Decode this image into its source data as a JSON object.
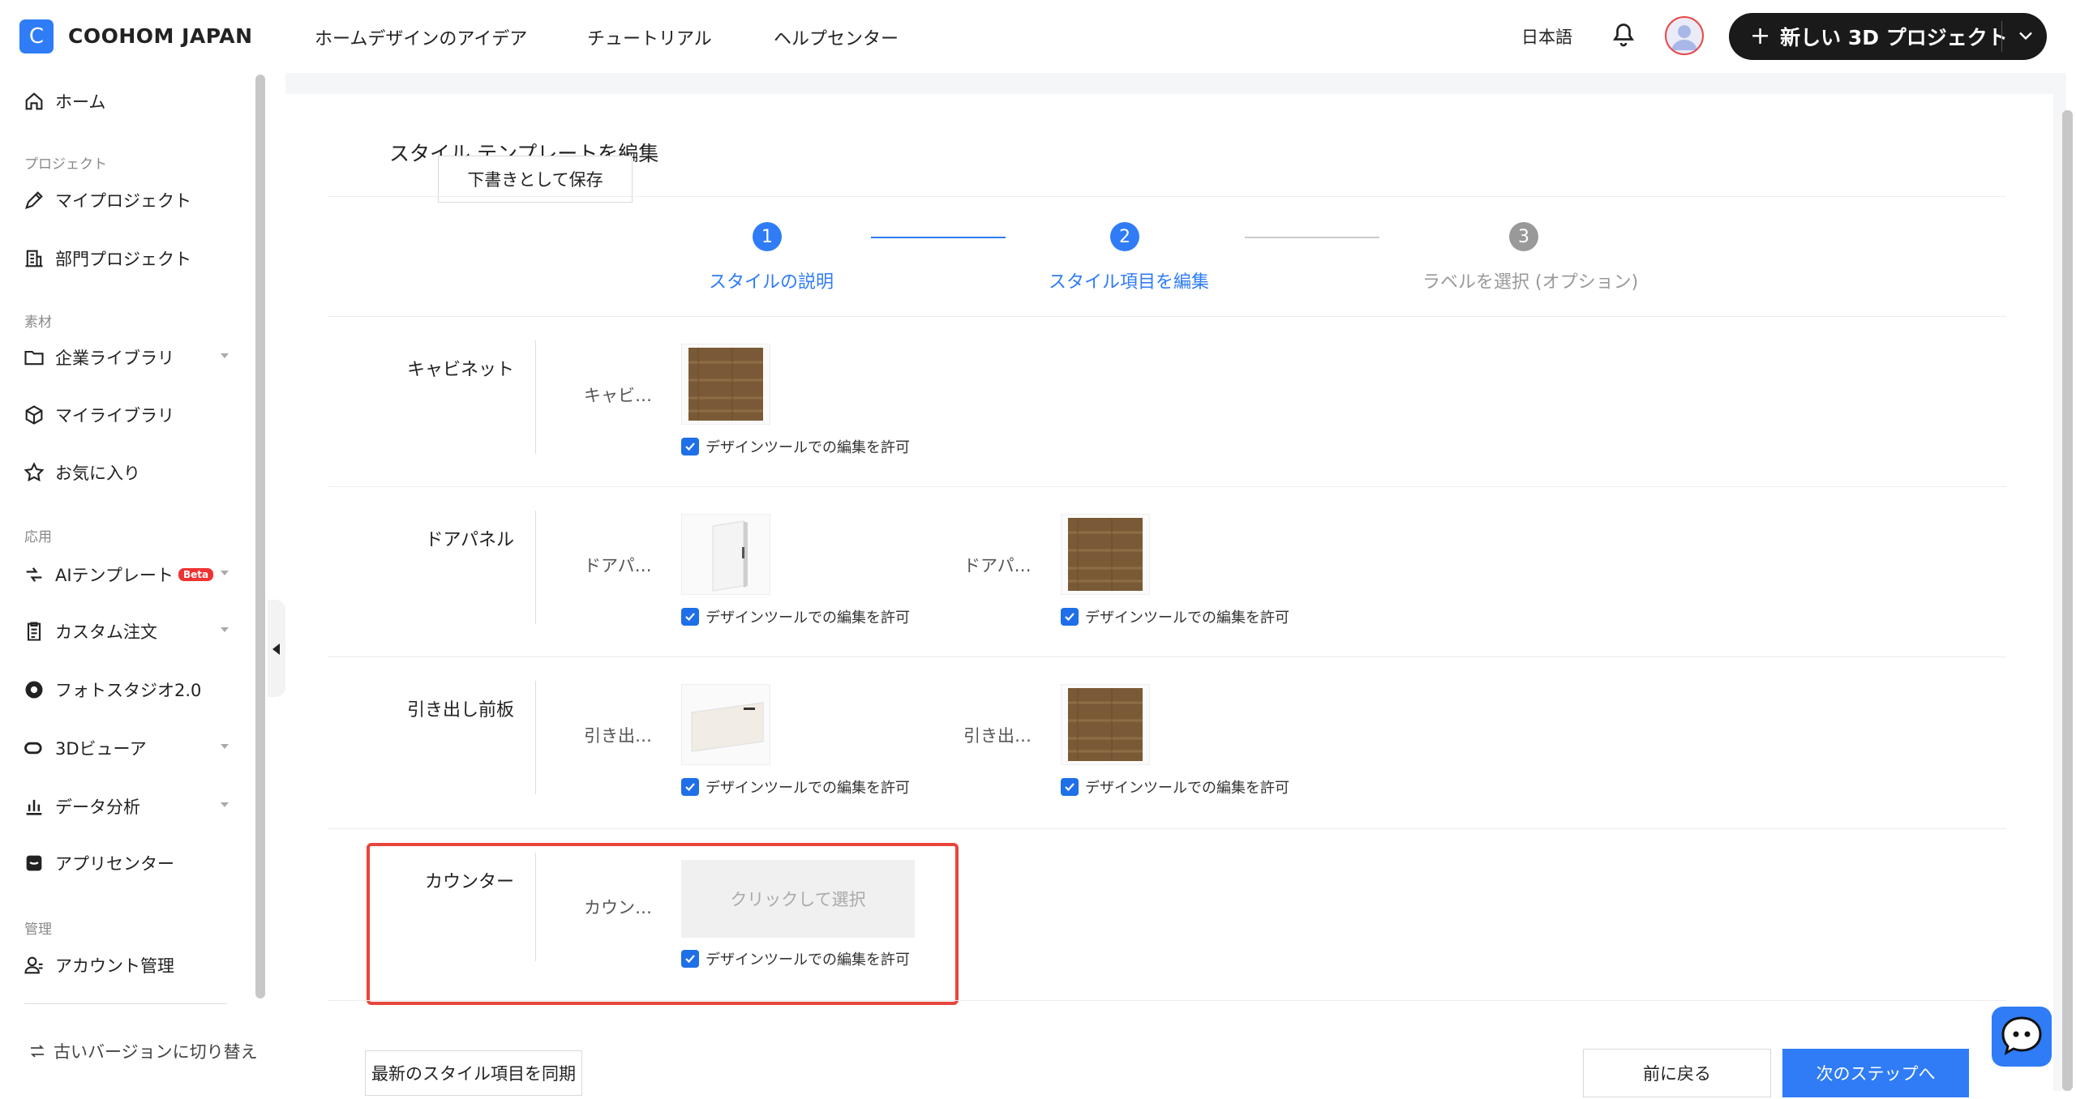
{
  "app": {
    "logo_letter": "C",
    "brand": "COOHOM JAPAN",
    "nav": [
      "ホームデザインのアイデア",
      "チュートリアル",
      "ヘルプセンター"
    ],
    "language": "日本語",
    "new_project_label": "新しい 3D プロジェクト"
  },
  "sidebar": {
    "home": "ホーム",
    "group_project": "プロジェクト",
    "my_projects": "マイプロジェクト",
    "dept_projects": "部門プロジェクト",
    "group_material": "素材",
    "enterprise_library": "企業ライブラリ",
    "my_library": "マイライブラリ",
    "favorites": "お気に入り",
    "group_apps": "応用",
    "ai_template": "AIテンプレート",
    "beta_badge": "Beta",
    "custom_order": "カスタム注文",
    "photo_studio": "フォトスタジオ2.0",
    "viewer_3d": "3Dビューア",
    "data_analysis": "データ分析",
    "app_center": "アプリセンター",
    "group_manage": "管理",
    "account_manage": "アカウント管理",
    "old_version": "古いバージョンに切り替え"
  },
  "editor": {
    "title": "スタイル テンプレートを編集",
    "save_draft": "下書きとして保存",
    "steps": [
      {
        "num": "1",
        "label": "スタイルの説明"
      },
      {
        "num": "2",
        "label": "スタイル項目を編集"
      },
      {
        "num": "3",
        "label": "ラベルを選択 (オプション)"
      }
    ],
    "allow_edit_label": "デザインツールでの編集を許可",
    "rows": [
      {
        "name": "キャビネット",
        "items": [
          "キャビ…"
        ]
      },
      {
        "name": "ドアパネル",
        "items": [
          "ドアパ…",
          "ドアパ…"
        ]
      },
      {
        "name": "引き出し前板",
        "items": [
          "引き出…",
          "引き出…"
        ]
      },
      {
        "name": "カウンター",
        "items": [
          "カウン…"
        ]
      }
    ],
    "click_to_select": "クリックして選択",
    "sync_button": "最新のスタイル項目を同期",
    "prev_button": "前に戻る",
    "next_button": "次のステップへ"
  },
  "colors": {
    "accent": "#2f7cf6",
    "highlight": "#e8463c",
    "wood": "#7a5a36"
  }
}
